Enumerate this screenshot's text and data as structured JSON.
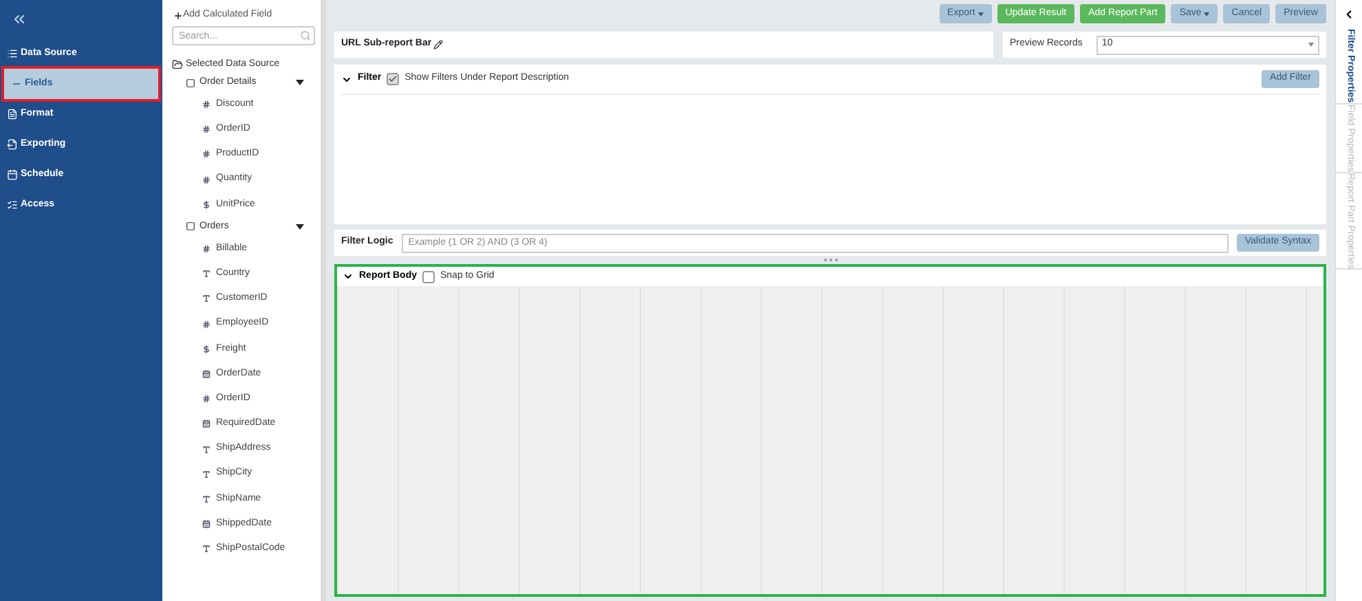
{
  "sidebar": {
    "items": [
      {
        "label": "Data Source",
        "selected": false
      },
      {
        "label": "Fields",
        "selected": true
      },
      {
        "label": "Format",
        "selected": false
      },
      {
        "label": "Exporting",
        "selected": false
      },
      {
        "label": "Schedule",
        "selected": false
      },
      {
        "label": "Access",
        "selected": false
      }
    ]
  },
  "fields_panel": {
    "add_button": "Add Calculated Field",
    "search": {
      "placeholder": "Search..."
    },
    "root": "Selected Data Source",
    "groups": [
      {
        "label": "Order Details",
        "expanded": true,
        "children": [
          {
            "label": "Discount",
            "kind": "number"
          },
          {
            "label": "OrderID",
            "kind": "number"
          },
          {
            "label": "ProductID",
            "kind": "number"
          },
          {
            "label": "Quantity",
            "kind": "number"
          },
          {
            "label": "UnitPrice",
            "kind": "money"
          }
        ]
      },
      {
        "label": "Orders",
        "expanded": true,
        "children": [
          {
            "label": "Billable",
            "kind": "number"
          },
          {
            "label": "Country",
            "kind": "text"
          },
          {
            "label": "CustomerID",
            "kind": "text"
          },
          {
            "label": "EmployeeID",
            "kind": "number"
          },
          {
            "label": "Freight",
            "kind": "money"
          },
          {
            "label": "OrderDate",
            "kind": "date"
          },
          {
            "label": "OrderID",
            "kind": "number"
          },
          {
            "label": "RequiredDate",
            "kind": "date"
          },
          {
            "label": "ShipAddress",
            "kind": "text"
          },
          {
            "label": "ShipCity",
            "kind": "text"
          },
          {
            "label": "ShipName",
            "kind": "text"
          },
          {
            "label": "ShippedDate",
            "kind": "date"
          },
          {
            "label": "ShipPostalCode",
            "kind": "text"
          }
        ]
      }
    ]
  },
  "toolbar": [
    {
      "label": "Export",
      "kind": "dropdown"
    },
    {
      "label": "Update Result",
      "kind": "primary"
    },
    {
      "label": "Add Report Part",
      "kind": "primary"
    },
    {
      "label": "Save",
      "kind": "dropdown"
    },
    {
      "label": "Cancel",
      "kind": "plain"
    },
    {
      "label": "Preview",
      "kind": "plain"
    }
  ],
  "title": "URL Sub-report Bar",
  "preview_records": {
    "label": "Preview Records",
    "value": "10"
  },
  "filter": {
    "title": "Filter",
    "show_under_description": {
      "label": "Show Filters Under Report Description",
      "checked": true
    },
    "add_button": "Add Filter",
    "logic_label": "Filter Logic",
    "logic_placeholder": "Example (1 OR 2) AND (3 OR 4)",
    "validate_button": "Validate Syntax"
  },
  "report_body": {
    "title": "Report Body",
    "snap_to_grid": {
      "label": "Snap to Grid",
      "checked": false
    }
  },
  "right_tabs": [
    {
      "label": "Filter Properties",
      "selected": true
    },
    {
      "label": "Field Properties",
      "selected": false
    },
    {
      "label": "Report Part Properties",
      "selected": false
    }
  ]
}
